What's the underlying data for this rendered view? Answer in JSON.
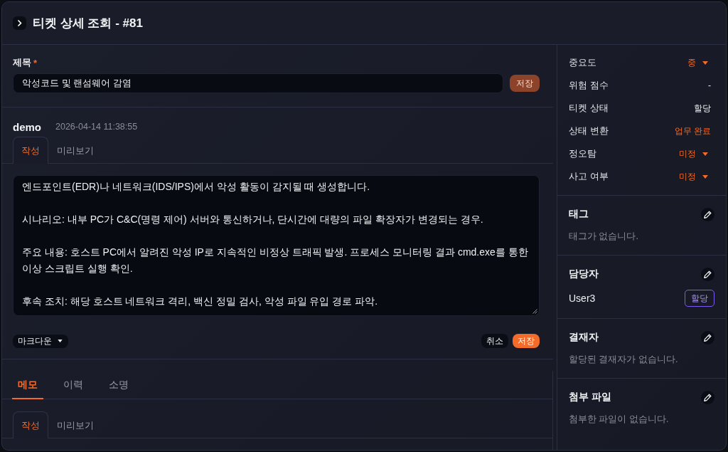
{
  "header": {
    "title": "티켓 상세 조회 - #81"
  },
  "title_field": {
    "label": "제목",
    "required_mark": "*",
    "value": "악성코드 및 랜섬웨어 감염",
    "save_button": {
      "label": "저장",
      "disabled": true
    }
  },
  "comment": {
    "author": "demo",
    "timestamp": "2026-04-14 11:38:55",
    "tabs": [
      {
        "label": "작성",
        "selected": true
      },
      {
        "label": "미리보기",
        "selected": false
      }
    ],
    "body": "엔드포인트(EDR)나 네트워크(IDS/IPS)에서 악성 활동이 감지될 때 생성합니다.\n\n시나리오: 내부 PC가 C&C(명령 제어) 서버와 통신하거나, 단시간에 대량의 파일 확장자가 변경되는 경우.\n\n주요 내용: 호스트 PC에서 알려진 악성 IP로 지속적인 비정상 트래픽 발생. 프로세스 모니터링 결과 cmd.exe를 통한 이상 스크립트 실행 확인.\n\n후속 조치: 해당 호스트 네트워크 격리, 백신 정밀 검사, 악성 파일 유입 경로 파악.",
    "format": "마크다운",
    "actions": [
      {
        "label": "취소",
        "kind": "secondary"
      },
      {
        "label": "저장",
        "kind": "primary"
      }
    ]
  },
  "memo_panel": {
    "tabs": [
      {
        "label": "메모",
        "selected": true
      },
      {
        "label": "이력",
        "selected": false
      },
      {
        "label": "소명",
        "selected": false
      }
    ],
    "editor_tabs": [
      {
        "label": "작성",
        "selected": true
      },
      {
        "label": "미리보기",
        "selected": false
      }
    ]
  },
  "sidebar": {
    "properties": [
      {
        "label": "중요도",
        "value": "중",
        "kind": "dropdown"
      },
      {
        "label": "위험 점수",
        "value": "-",
        "kind": "text"
      },
      {
        "label": "티켓 상태",
        "value": "할당",
        "kind": "text"
      },
      {
        "label": "상태 변환",
        "value": "업무 완료",
        "kind": "link"
      },
      {
        "label": "정오탐",
        "value": "미정",
        "kind": "dropdown"
      },
      {
        "label": "사고 여부",
        "value": "미정",
        "kind": "dropdown"
      }
    ],
    "sections": [
      {
        "title": "태그",
        "kind": "empty",
        "empty_text": "태그가 없습니다."
      },
      {
        "title": "담당자",
        "kind": "assignees",
        "assignees": [
          {
            "name": "User3",
            "status": "할당"
          }
        ]
      },
      {
        "title": "결재자",
        "kind": "empty",
        "empty_text": "할당된 결재자가 없습니다."
      },
      {
        "title": "첨부 파일",
        "kind": "empty",
        "empty_text": "첨부한 파일이 없습니다."
      }
    ]
  }
}
